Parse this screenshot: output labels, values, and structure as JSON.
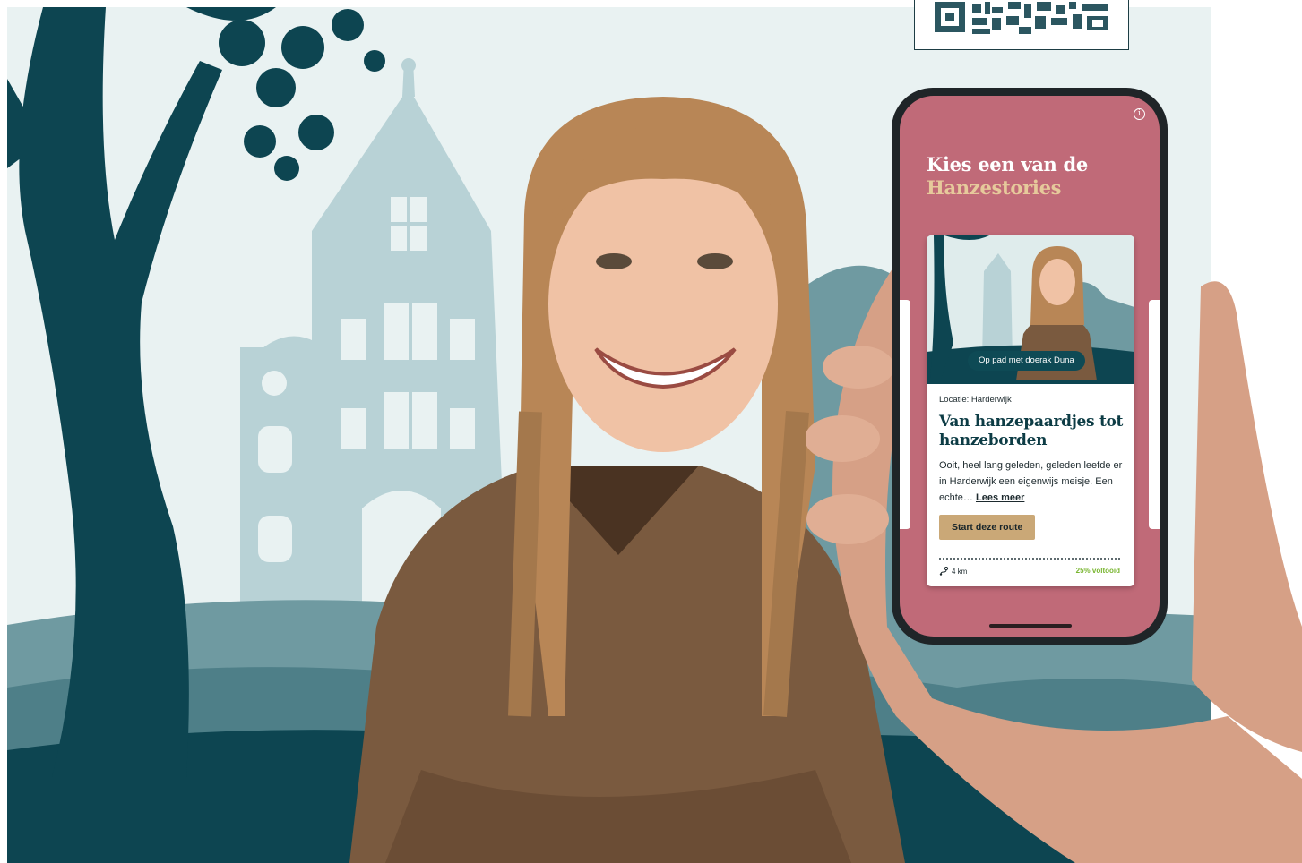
{
  "scene": {
    "colors": {
      "background": "#e9f2f2",
      "silhouette_light": "#b8d2d6",
      "silhouette_mid": "#6f9aa1",
      "silhouette_dark": "#0d4551",
      "qr_frame": "#1d3d44"
    },
    "qr_code": "qr-code-icon"
  },
  "phone": {
    "screen_color": "#c06a78",
    "accent_color": "#e6c99b",
    "info_icon": "info-icon",
    "heading_line1": "Kies een van de",
    "heading_line2": "Hanzestories",
    "card": {
      "image_badge": "Op pad met doerak Duna",
      "location": "Locatie: Harderwijk",
      "title": "Van hanzepaardjes tot hanzeborden",
      "description": "Ooit, heel lang geleden, geleden leefde er in Harderwijk een eigenwijs meisje. Een echte…",
      "read_more": "Lees meer",
      "start_button": "Start deze route",
      "distance_icon": "route-icon",
      "distance": "4 km",
      "progress_text": "25% voltooid",
      "progress_color": "#79b530",
      "button_color": "#caa877"
    }
  }
}
